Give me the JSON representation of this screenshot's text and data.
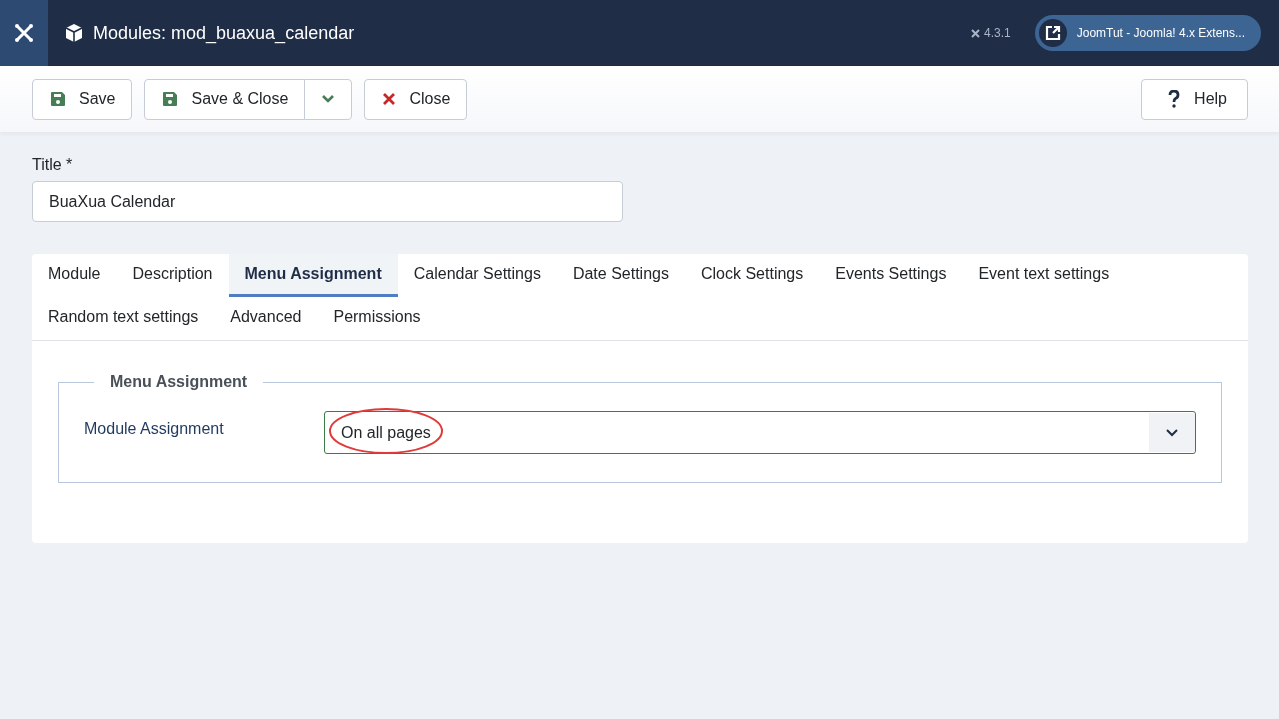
{
  "header": {
    "title": "Modules: mod_buaxua_calendar",
    "version": "4.3.1",
    "site_link": "JoomTut - Joomla! 4.x Extens..."
  },
  "toolbar": {
    "buttons": [
      {
        "label": "Save",
        "kind": "save"
      },
      {
        "label": "Save & Close",
        "kind": "save-dropdown"
      },
      {
        "label": "Close",
        "kind": "close"
      }
    ],
    "help": "Help"
  },
  "title_field": {
    "label": "Title *",
    "value": "BuaXua Calendar"
  },
  "tabs": [
    {
      "label": "Module",
      "selected": false
    },
    {
      "label": "Description",
      "selected": false
    },
    {
      "label": "Menu Assignment",
      "selected": true
    },
    {
      "label": "Calendar Settings",
      "selected": false
    },
    {
      "label": "Date Settings",
      "selected": false
    },
    {
      "label": "Clock Settings",
      "selected": false
    },
    {
      "label": "Events Settings",
      "selected": false
    },
    {
      "label": "Event text settings",
      "selected": false
    },
    {
      "label": "Random text settings",
      "selected": false
    },
    {
      "label": "Advanced",
      "selected": false
    },
    {
      "label": "Permissions",
      "selected": false
    }
  ],
  "panel": {
    "legend": "Menu Assignment",
    "field_label": "Module Assignment",
    "select_value": "On all pages",
    "highlighted": true
  }
}
